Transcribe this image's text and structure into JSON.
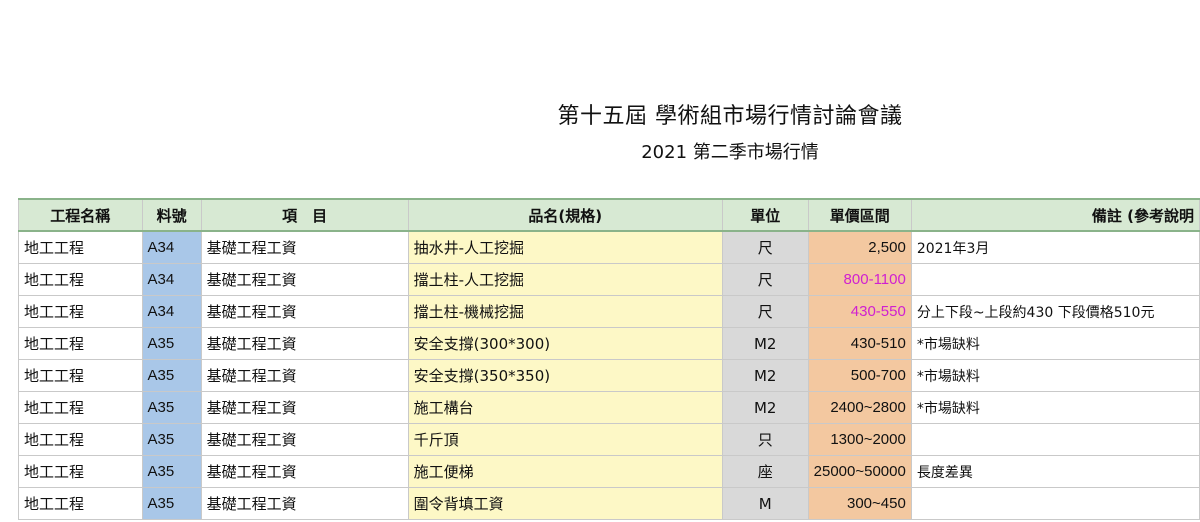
{
  "header": {
    "title": "第十五屆 學術組市場行情討論會議",
    "subtitle": "2021 第二季市場行情"
  },
  "table": {
    "columns": [
      "工程名稱",
      "料號",
      "項　目",
      "品名(規格)",
      "單位",
      "單價區間",
      "備註 (參考說明"
    ],
    "rows": [
      {
        "name": "地工工程",
        "code": "A34",
        "item": "基礎工程工資",
        "spec": "抽水井-人工挖掘",
        "unit": "尺",
        "price": "2,500",
        "note": "2021年3月",
        "price_color": "#111111"
      },
      {
        "name": "地工工程",
        "code": "A34",
        "item": "基礎工程工資",
        "spec": "擋土柱-人工挖掘",
        "unit": "尺",
        "price": "800-1100",
        "note": "",
        "price_color": "#d020d0"
      },
      {
        "name": "地工工程",
        "code": "A34",
        "item": "基礎工程工資",
        "spec": "擋土柱-機械挖掘",
        "unit": "尺",
        "price": "430-550",
        "note": "分上下段~上段約430 下段價格510元",
        "price_color": "#d020d0"
      },
      {
        "name": "地工工程",
        "code": "A35",
        "item": "基礎工程工資",
        "spec": "安全支撐(300*300)",
        "unit": "M2",
        "price": "430-510",
        "note": "*市場缺料",
        "price_color": "#111111"
      },
      {
        "name": "地工工程",
        "code": "A35",
        "item": "基礎工程工資",
        "spec": "安全支撐(350*350)",
        "unit": "M2",
        "price": "500-700",
        "note": "*市場缺料",
        "price_color": "#111111"
      },
      {
        "name": "地工工程",
        "code": "A35",
        "item": "基礎工程工資",
        "spec": "施工構台",
        "unit": "M2",
        "price": "2400~2800",
        "note": "*市場缺料",
        "price_color": "#111111"
      },
      {
        "name": "地工工程",
        "code": "A35",
        "item": "基礎工程工資",
        "spec": "千斤頂",
        "unit": "只",
        "price": "1300~2000",
        "note": "",
        "price_color": "#111111"
      },
      {
        "name": "地工工程",
        "code": "A35",
        "item": "基礎工程工資",
        "spec": "施工便梯",
        "unit": "座",
        "price": "25000~50000",
        "note": "長度差異",
        "price_color": "#111111"
      },
      {
        "name": "地工工程",
        "code": "A35",
        "item": "基礎工程工資",
        "spec": "圍令背填工資",
        "unit": "M",
        "price": "300~450",
        "note": "",
        "price_color": "#111111"
      }
    ]
  }
}
